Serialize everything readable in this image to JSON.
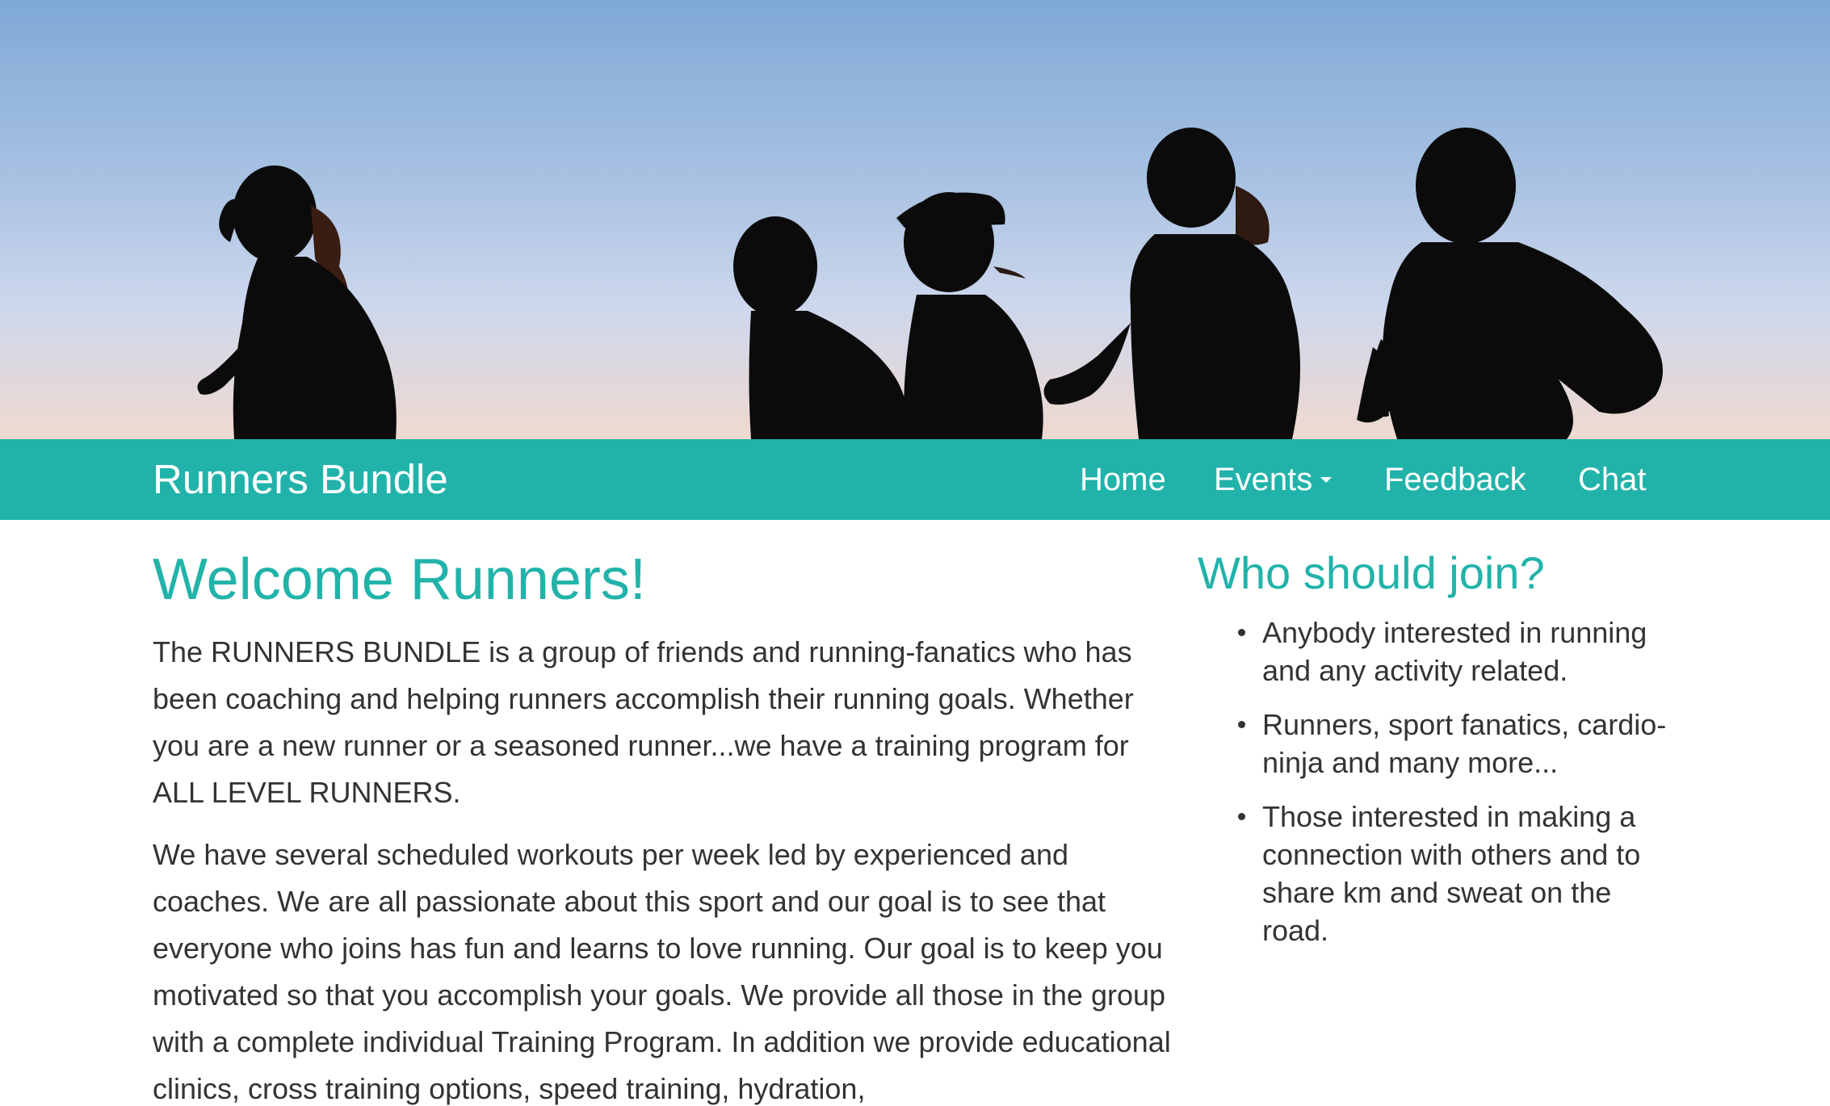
{
  "navbar": {
    "brand": "Runners Bundle",
    "items": [
      {
        "label": "Home"
      },
      {
        "label": "Events",
        "has_dropdown": true
      },
      {
        "label": "Feedback"
      },
      {
        "label": "Chat"
      }
    ]
  },
  "main": {
    "title": "Welcome Runners!",
    "paragraphs": [
      "The RUNNERS BUNDLE is a group of friends and running-fanatics who has been coaching and helping runners accomplish their running goals. Whether you are a new runner or a seasoned runner...we have a training program for ALL LEVEL RUNNERS.",
      "We have several scheduled workouts per week led by experienced and coaches. We are all passionate about this sport and our goal is to see that everyone who joins has fun and learns to love running. Our goal is to keep you motivated so that you accomplish your goals. We provide all those in the group with a complete individual Training Program. In addition we provide educational clinics, cross training options, speed training, hydration,"
    ]
  },
  "sidebar": {
    "title": "Who should join?",
    "items": [
      "Anybody interested in running and any activity related.",
      "Runners, sport fanatics, cardio-ninja and many more...",
      "Those interested in making a connection with others and to share km and sweat on the road."
    ]
  },
  "colors": {
    "accent": "#21b3aa",
    "text": "#333333",
    "sky_top": "#7fa8d6",
    "sky_bottom": "#f0d9d0"
  }
}
